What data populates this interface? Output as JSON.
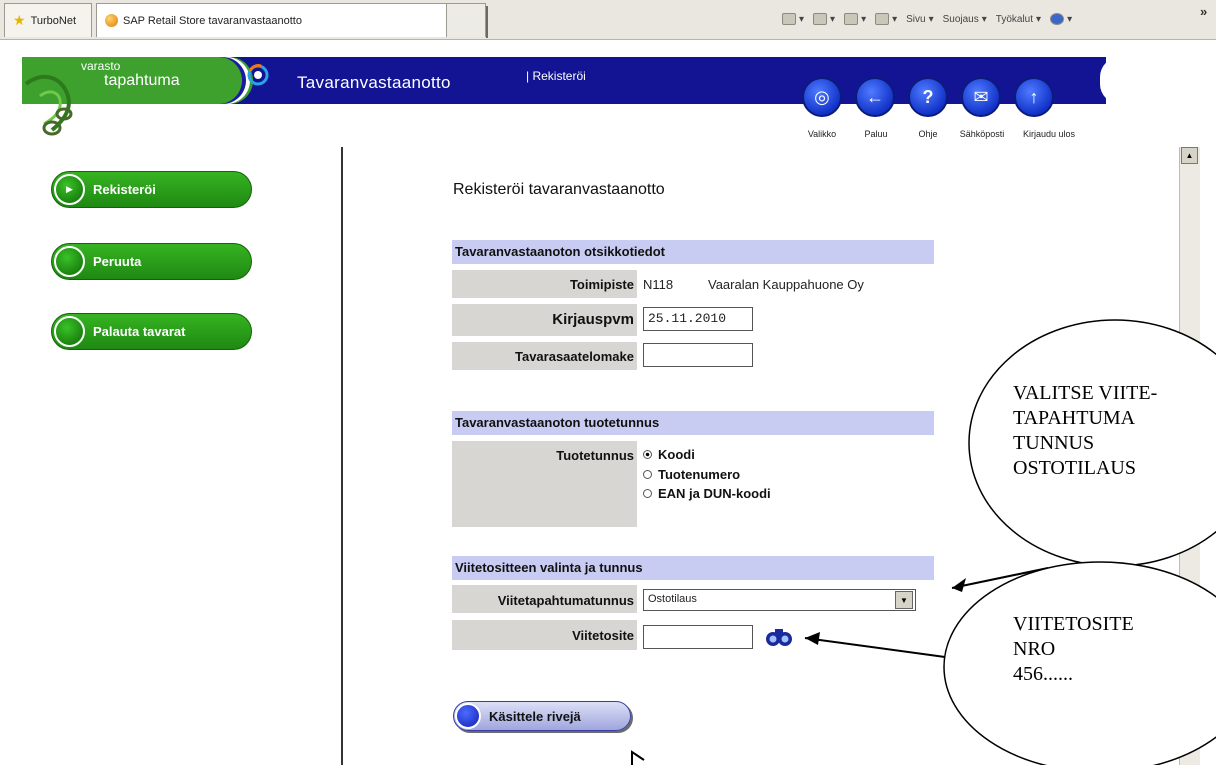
{
  "browser": {
    "tabs": [
      {
        "label": "TurboNet",
        "icon": "star-icon"
      },
      {
        "label": "SAP Retail Store tavaranvastaanotto",
        "icon": "sap-icon"
      }
    ],
    "commands": [
      {
        "label": "",
        "icon": "home-icon"
      },
      {
        "label": "",
        "icon": "feeds-icon"
      },
      {
        "label": "",
        "icon": "mail-icon"
      },
      {
        "label": "Sivu",
        "icon": "page-icon"
      },
      {
        "label": "Suojaus",
        "icon": "safety-icon"
      },
      {
        "label": "Työkalut",
        "icon": "tools-icon"
      }
    ],
    "overflow": "»"
  },
  "app": {
    "logo_small": "varasto",
    "logo_big": "tapahtuma",
    "title": "Tavaranvastaanotto",
    "subtitle": "| Rekisteröi",
    "nav": [
      {
        "label": "Valikko",
        "glyph": "◎"
      },
      {
        "label": "Paluu",
        "glyph": "←"
      },
      {
        "label": "Ohje",
        "glyph": "?"
      },
      {
        "label": "Sähköposti",
        "glyph": "✉"
      },
      {
        "label": "Kirjaudu ulos",
        "glyph": "↑"
      }
    ]
  },
  "sidebar": {
    "items": [
      {
        "label": "Rekisteröi"
      },
      {
        "label": "Peruuta"
      },
      {
        "label": "Palauta tavarat"
      }
    ]
  },
  "form": {
    "title": "Rekisteröi tavaranvastaanotto",
    "header_section": "Tavaranvastaanoton otsikkotiedot",
    "site_label": "Toimipiste",
    "site_code": "N118",
    "site_name": "Vaaralan Kauppahuone Oy",
    "posting_label": "Kirjauspvm",
    "posting_value": "25.11.2010",
    "delivery_note_label": "Tavarasaatelomake",
    "delivery_note_value": "",
    "product_section": "Tavaranvastaanoton tuotetunnus",
    "product_label": "Tuotetunnus",
    "product_options": [
      "Koodi",
      "Tuotenumero",
      "EAN ja DUN-koodi"
    ],
    "product_selected": "Koodi",
    "reference_section": "Viitetositteen valinta ja tunnus",
    "reference_type_label": "Viitetapahtumatunnus",
    "reference_type_value": "Ostotilaus",
    "reference_doc_label": "Viitetosite",
    "reference_doc_value": "",
    "process_button": "Käsittele rivejä"
  },
  "annotations": {
    "callout1": "VALITSE VIITE-\nTAPAHTUMA\nTUNNUS\nOSTOTILAUS",
    "callout2": "VIITETOSITE\nNRO\n456......"
  }
}
